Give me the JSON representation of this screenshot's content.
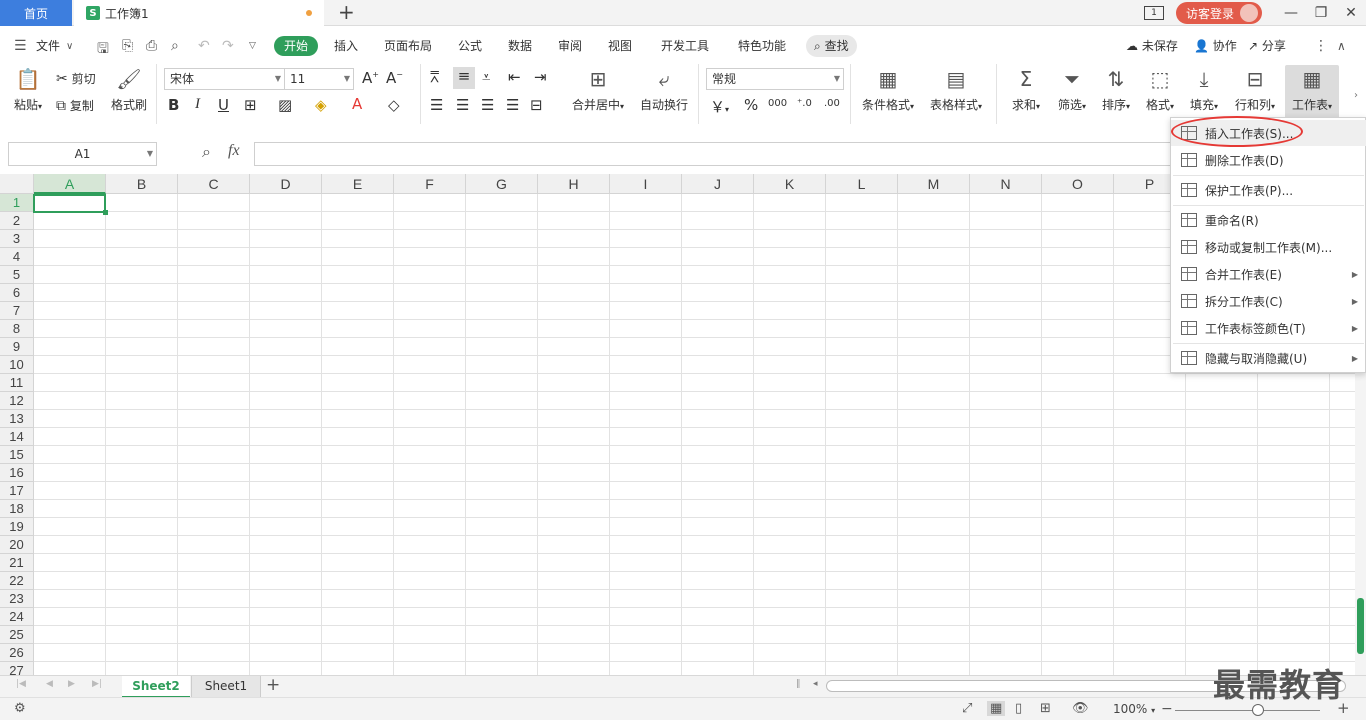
{
  "titlebar": {
    "home_tab": "首页",
    "doc_logo": "S",
    "doc_tab": "工作簿1",
    "add_tab": "+",
    "window_count": "1",
    "login": "访客登录",
    "minimize": "—",
    "restore": "❐",
    "close": "✕"
  },
  "menubar": {
    "file": "文件",
    "tabs": [
      "开始",
      "插入",
      "页面布局",
      "公式",
      "数据",
      "审阅",
      "视图",
      "开发工具",
      "特色功能"
    ],
    "search": "查找",
    "unsaved": "未保存",
    "collab": "协作",
    "share": "分享"
  },
  "ribbon": {
    "paste": "粘贴",
    "cut": "剪切",
    "copy": "复制",
    "format_painter": "格式刷",
    "font_name": "宋体",
    "font_size": "11",
    "merge_center": "合并居中",
    "wrap_text": "自动换行",
    "number_format": "常规",
    "currency": "￥",
    "percent": "%",
    "thousands": "000",
    "cond_format": "条件格式",
    "table_style": "表格样式",
    "sum": "求和",
    "filter": "筛选",
    "sort": "排序",
    "format": "格式",
    "fill": "填充",
    "row_col": "行和列",
    "worksheet": "工作表"
  },
  "formulabar": {
    "name_box": "A1",
    "fx": "fx",
    "value": ""
  },
  "grid": {
    "columns": [
      "A",
      "B",
      "C",
      "D",
      "E",
      "F",
      "G",
      "H",
      "I",
      "J",
      "K",
      "L",
      "M",
      "N",
      "O",
      "P"
    ],
    "rows": [
      "1",
      "2",
      "3",
      "4",
      "5",
      "6",
      "7",
      "8",
      "9",
      "10",
      "11",
      "12",
      "13",
      "14",
      "15",
      "16",
      "17",
      "18",
      "19",
      "20",
      "21",
      "22",
      "23",
      "24",
      "25",
      "26",
      "27"
    ]
  },
  "sheets": {
    "active": "Sheet2",
    "other": "Sheet1",
    "add": "+"
  },
  "status": {
    "zoom": "100%"
  },
  "dropdown": {
    "items": [
      {
        "label": "插入工作表(S)...",
        "has_sub": false
      },
      {
        "label": "删除工作表(D)",
        "has_sub": false
      },
      {
        "label": "保护工作表(P)...",
        "has_sub": false
      },
      {
        "label": "重命名(R)",
        "has_sub": false
      },
      {
        "label": "移动或复制工作表(M)...",
        "has_sub": false
      },
      {
        "label": "合并工作表(E)",
        "has_sub": true
      },
      {
        "label": "拆分工作表(C)",
        "has_sub": true
      },
      {
        "label": "工作表标签颜色(T)",
        "has_sub": true
      },
      {
        "label": "隐藏与取消隐藏(U)",
        "has_sub": true
      }
    ]
  },
  "watermark": "最需教育",
  "colors": {
    "accent": "#2f9e5b",
    "home_tab": "#3d7ede",
    "login": "#e25b4a",
    "highlight": "#e53935"
  }
}
